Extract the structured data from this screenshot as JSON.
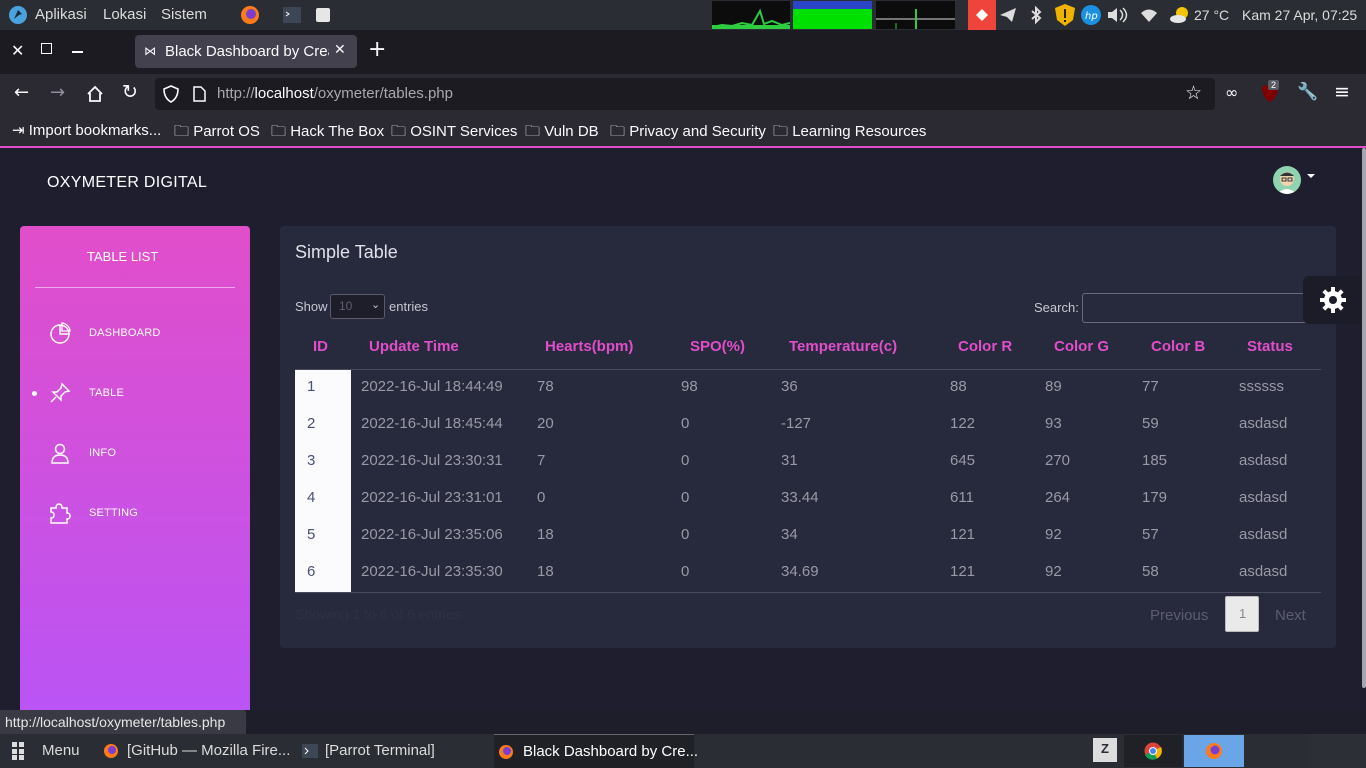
{
  "system_panel": {
    "menus": [
      "Aplikasi",
      "Lokasi",
      "Sistem"
    ],
    "temperature": "27 °C",
    "datetime": "Kam 27 Apr, 07:25"
  },
  "browser": {
    "tab_title": "Black Dashboard by Creat",
    "url_prefix": "http://",
    "url_host": "localhost",
    "url_path": "/oxymeter/tables.php",
    "extension_badge": "2",
    "bookmarks": [
      "Import bookmarks...",
      "Parrot OS",
      "Hack The Box",
      "OSINT Services",
      "Vuln DB",
      "Privacy and Security",
      "Learning Resources"
    ],
    "status_url": "http://localhost/oxymeter/tables.php"
  },
  "page": {
    "brand": "OXYMETER DIGITAL",
    "sidebar": {
      "title": "TABLE LIST",
      "items": [
        {
          "label": "DASHBOARD",
          "icon": "pie-chart-icon"
        },
        {
          "label": "TABLE",
          "icon": "pin-icon"
        },
        {
          "label": "INFO",
          "icon": "user-icon"
        },
        {
          "label": "SETTING",
          "icon": "puzzle-icon"
        }
      ]
    },
    "card": {
      "title": "Simple Table",
      "show_label": "Show",
      "entries_label": "entries",
      "page_length": "10",
      "search_label": "Search:",
      "columns": [
        "ID",
        "Update Time",
        "Hearts(bpm)",
        "SPO(%)",
        "Temperature(c)",
        "Color R",
        "Color G",
        "Color B",
        "Status"
      ],
      "rows": [
        [
          "1",
          "2022-16-Jul 18:44:49",
          "78",
          "98",
          "36",
          "88",
          "89",
          "77",
          "ssssss"
        ],
        [
          "2",
          "2022-16-Jul 18:45:44",
          "20",
          "0",
          "-127",
          "122",
          "93",
          "59",
          "asdasd"
        ],
        [
          "3",
          "2022-16-Jul 23:30:31",
          "7",
          "0",
          "31",
          "645",
          "270",
          "185",
          "asdasd"
        ],
        [
          "4",
          "2022-16-Jul 23:31:01",
          "0",
          "0",
          "33.44",
          "611",
          "264",
          "179",
          "asdasd"
        ],
        [
          "5",
          "2022-16-Jul 23:35:06",
          "18",
          "0",
          "34",
          "121",
          "92",
          "57",
          "asdasd"
        ],
        [
          "6",
          "2022-16-Jul 23:35:30",
          "18",
          "0",
          "34.69",
          "121",
          "92",
          "58",
          "asdasd"
        ]
      ],
      "info": "Showing 1 to 6 of 6 entries",
      "pagination": {
        "previous": "Previous",
        "current": "1",
        "next": "Next"
      }
    }
  },
  "taskbar": {
    "menu_label": "Menu",
    "windows": [
      "[GitHub — Mozilla Fire...",
      "[Parrot Terminal]",
      "Black Dashboard by Cre..."
    ]
  },
  "colors": {
    "accent": "#e14eca",
    "gradient_end": "#ba54f5",
    "card": "#27293d",
    "page": "#1e1e2f"
  }
}
